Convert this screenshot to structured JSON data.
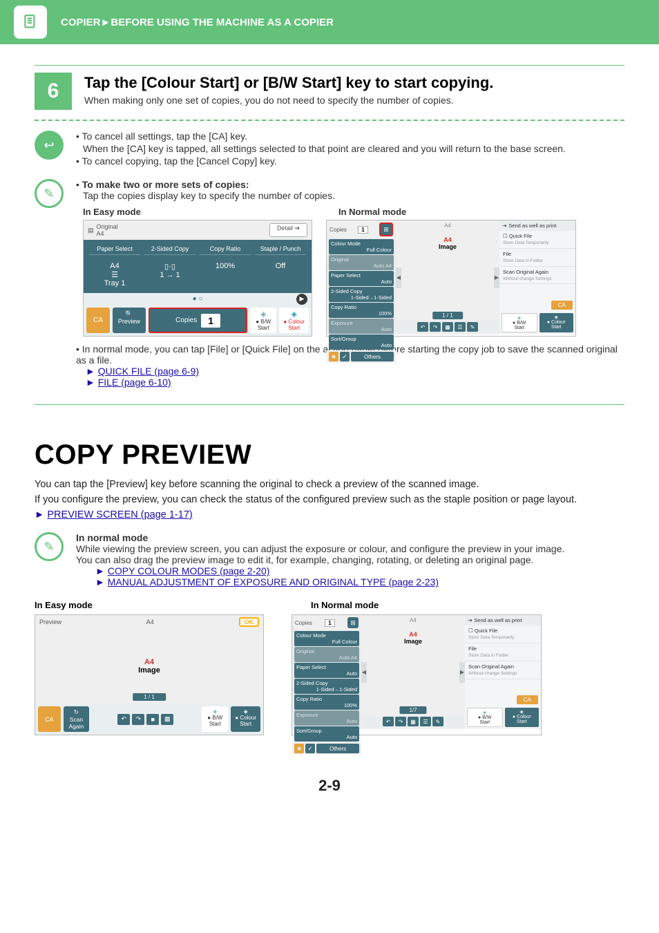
{
  "header": {
    "breadcrumb_section": "COPIER",
    "breadcrumb_arrow": "►",
    "breadcrumb_page": "BEFORE USING THE MACHINE AS A COPIER"
  },
  "step6": {
    "number": "6",
    "title": "Tap the [Colour Start] or [B/W Start] key to start copying.",
    "desc": "When making only one set of copies, you do not need to specify the number of copies."
  },
  "cancel_note": {
    "bullet1": "To cancel all settings, tap the [CA] key.",
    "bullet1_sub": "When the [CA] key is tapped, all settings selected to that point are cleared and you will return to the base screen.",
    "bullet2": "To cancel copying, tap the [Cancel Copy] key."
  },
  "multi_note": {
    "title": "To make two or more sets of copies:",
    "desc": "Tap the copies display key to specify the number of copies.",
    "easy_label": "In Easy mode",
    "normal_label": "In Normal mode"
  },
  "easy_ss": {
    "original_label": "Original",
    "original_value": "A4",
    "detail": "Detail",
    "cols": [
      "Paper Select",
      "2-Sided Copy",
      "Copy Ratio",
      "Staple / Punch"
    ],
    "vals_line1": [
      "A4",
      "",
      "",
      ""
    ],
    "vals_line2": [
      "☰",
      "▯·▯",
      "100%",
      "Off"
    ],
    "vals_line3": [
      "Tray 1",
      "1 → 1",
      "",
      ""
    ],
    "ca": "CA",
    "preview": "Preview",
    "copies": "Copies",
    "copies_num": "1",
    "bw": "B/W",
    "start": "Start",
    "colour": "Colour"
  },
  "normal_ss": {
    "copies": "Copies",
    "copies_num": "1",
    "items": [
      {
        "label": "Colour Mode",
        "value": "Full Colour",
        "dim": false
      },
      {
        "label": "Original",
        "value": "Auto  A4",
        "dim": true
      },
      {
        "label": "Paper Select",
        "value": "Auto",
        "dim": false
      },
      {
        "label": "2-Sided Copy",
        "value": "1-Sided→1-Sided",
        "dim": false
      },
      {
        "label": "Copy Ratio",
        "value": "100%",
        "dim": false
      },
      {
        "label": "Exposure",
        "value": "Auto",
        "dim": true
      },
      {
        "label": "Sort/Group",
        "value": "Auto",
        "dim": false
      }
    ],
    "others": "Others",
    "center_header": "A4",
    "page_title": "A4",
    "page_image": "Image",
    "pager": "1 / 1",
    "right": {
      "send_print": "Send as well as print",
      "quick_file": "Quick File",
      "quick_file_sub": "Store Data Temporarily",
      "file": "File",
      "file_sub": "Store Data in Folder",
      "scan_again": "Scan Original Again",
      "scan_again_sub": "Without change Settings",
      "ca": "CA",
      "bw": "B/W",
      "start": "Start",
      "colour": "Colour"
    }
  },
  "after_ss": {
    "text": "In normal mode, you can tap [File] or [Quick File] on the action panel before starting the copy job to save the scanned original as a file.",
    "link_quick": "QUICK FILE (page 6-9)",
    "link_file": "FILE (page 6-10)"
  },
  "copy_preview": {
    "title": "COPY PREVIEW",
    "p1": "You can tap the [Preview] key before scanning the original to check a preview of the scanned image.",
    "p2": "If you configure the preview, you can check the status of the configured preview such as the staple position or page layout.",
    "link_preview": "PREVIEW SCREEN (page 1-17)"
  },
  "preview_note": {
    "heading": "In normal mode",
    "line1": "While viewing the preview screen, you can adjust the exposure or colour, and configure the preview in your image.",
    "line2": "You can also drag the preview image to edit it, for example, changing, rotating, or deleting an original page.",
    "link_colour": "COPY COLOUR MODES (page 2-20)",
    "link_exposure": "MANUAL ADJUSTMENT OF EXPOSURE AND ORIGINAL TYPE (page 2-23)"
  },
  "preview_labels": {
    "easy": "In Easy mode",
    "normal": "In Normal mode"
  },
  "preview_easy_ss": {
    "title": "Preview",
    "header": "A4",
    "ok": "OK",
    "page_title": "A4",
    "page_image": "Image",
    "pager": "1 / 1",
    "ca": "CA",
    "scan_again1": "Scan",
    "scan_again2": "Again",
    "bw": "B/W",
    "start": "Start",
    "colour": "Colour"
  },
  "preview_normal_ss": {
    "pager": "1/7"
  },
  "page_number": "2-9"
}
